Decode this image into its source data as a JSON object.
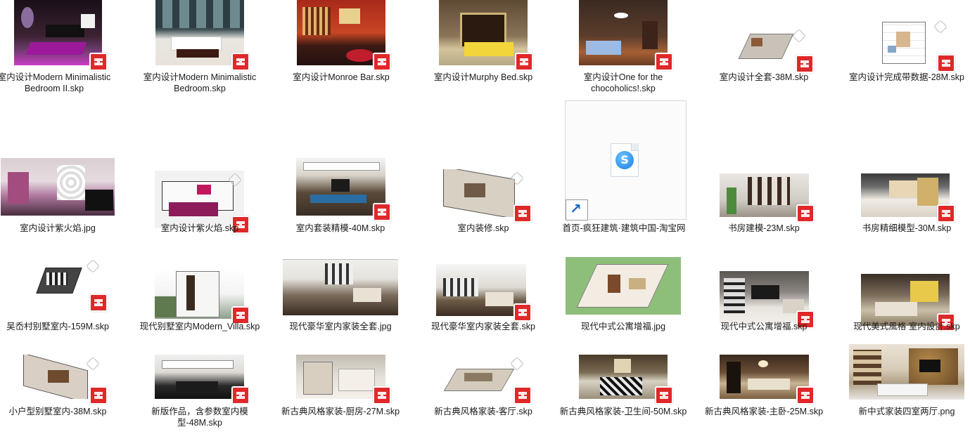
{
  "files": [
    {
      "name": "室内设计Modern Minimalistic Bedroom II.skp"
    },
    {
      "name": "室内设计Modern Minimalistic Bedroom.skp"
    },
    {
      "name": "室内设计Monroe Bar.skp"
    },
    {
      "name": "室内设计Murphy Bed.skp"
    },
    {
      "name": "室内设计One for the chocoholics!.skp"
    },
    {
      "name": "室内设计全套-38M.skp"
    },
    {
      "name": "室内设计完成带数据-28M.skp"
    },
    {
      "name": "室内设计紫火焰.jpg"
    },
    {
      "name": "室内设计紫火焰.skp"
    },
    {
      "name": "室内套装精模-40M.skp"
    },
    {
      "name": "室内装修.skp"
    },
    {
      "name": "首页-疯狂建筑·建筑中国-淘宝网"
    },
    {
      "name": "书房建模-23M.skp"
    },
    {
      "name": "书房精细模型-30M.skp"
    },
    {
      "name": "吴岙村别墅室内-159M.skp"
    },
    {
      "name": "现代别墅室内Modern_Villa.skp"
    },
    {
      "name": "现代豪华室内家装全套.jpg"
    },
    {
      "name": "现代豪华室内家装全套.skp"
    },
    {
      "name": "现代中式公寓增福.jpg"
    },
    {
      "name": "现代中式公寓增福.skp"
    },
    {
      "name": "现代美式風格 室内設計.skp"
    },
    {
      "name": "小户型别墅室内-38M.skp"
    },
    {
      "name": "新版作品，含参数室内模型-48M.skp"
    },
    {
      "name": "新古典风格家装-厨房-27M.skp"
    },
    {
      "name": "新古典风格家装-客厅.skp"
    },
    {
      "name": "新古典风格家装-卫生间-50M.skp"
    },
    {
      "name": "新古典风格家装-主卧-25M.skp"
    },
    {
      "name": "新中式家装四室两厅.png"
    }
  ],
  "icons": {
    "sketchup_badge": "sketchup-icon",
    "shortcut": "shortcut-arrow-icon",
    "sogou": "sogou-browser-icon"
  },
  "colors": {
    "badge": "#e0282a",
    "label": "#1a1a1a"
  }
}
